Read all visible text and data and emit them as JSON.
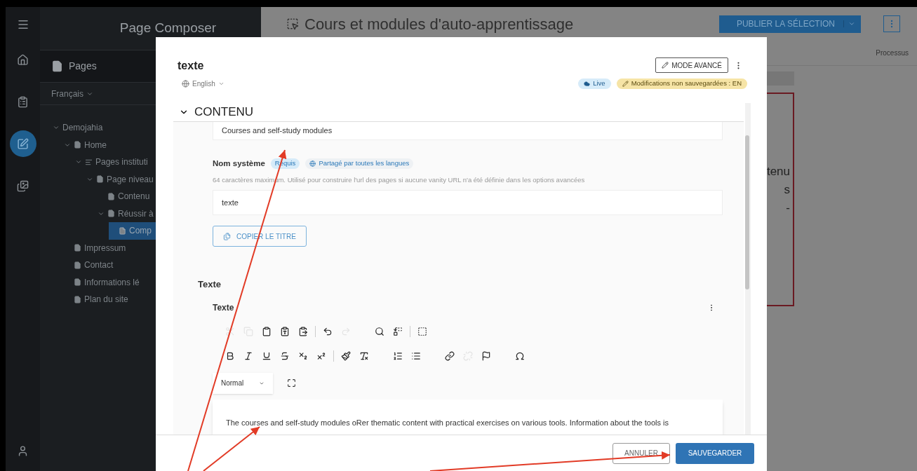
{
  "rail": {
    "items": [
      {
        "kind": "home",
        "selected": false
      },
      {
        "kind": "clipboard",
        "selected": false
      },
      {
        "kind": "edit",
        "selected": true
      },
      {
        "kind": "images",
        "selected": false
      }
    ]
  },
  "sidebar": {
    "title": "Page Composer",
    "section": "Pages",
    "language": "Français",
    "tree": [
      {
        "label": "Demojahia",
        "expanded": true,
        "selected": false,
        "children": [
          {
            "label": "Home",
            "kind": "page",
            "expanded": true,
            "selected": false,
            "children": [
              {
                "label": "Pages instituti",
                "kind": "list",
                "expanded": true,
                "selected": false,
                "children": [
                  {
                    "label": "Page niveau",
                    "kind": "page",
                    "expanded": true,
                    "selected": false,
                    "children": [
                      {
                        "label": "Contenu",
                        "kind": "page",
                        "selected": false
                      },
                      {
                        "label": "Réussir à",
                        "kind": "page",
                        "expanded": true,
                        "selected": false,
                        "children": [
                          {
                            "label": "Comp",
                            "kind": "page",
                            "selected": true
                          }
                        ]
                      }
                    ]
                  }
                ]
              }
            ]
          },
          {
            "label": "Impressum",
            "kind": "page",
            "selected": false
          },
          {
            "label": "Contact",
            "kind": "page",
            "selected": false
          },
          {
            "label": "Informations lé",
            "kind": "page",
            "selected": false
          },
          {
            "label": "Plan du site",
            "kind": "page",
            "selected": false
          }
        ]
      }
    ]
  },
  "main": {
    "title": "Cours et modules d'auto-apprentissage",
    "publish_button": "PUBLIER LA SÉLECTION",
    "column_header": "Processus",
    "preview_lines": [
      "tenu",
      "s",
      "-"
    ]
  },
  "dialog": {
    "title": "texte",
    "language": "English",
    "advanced_button": "MODE AVANCÉ",
    "badges": [
      {
        "label": "Live",
        "kind": "live"
      },
      {
        "label": "Modifications non sauvegardées : EN",
        "kind": "unsaved"
      }
    ],
    "section": {
      "title": "CONTENU",
      "expanded": true
    },
    "title_value": "Courses and self-study modules",
    "system_name": {
      "label": "Nom système",
      "badges": [
        {
          "label": "Requis",
          "kind": "required"
        },
        {
          "label": "Partagé par toutes les langues",
          "kind": "shared"
        }
      ],
      "help": "64 caractères maximum. Utilisé pour construire l'url des pages si aucune vanity URL n'a été définie dans les options avancées",
      "value": "texte"
    },
    "copy_button": "COPIER LE TITRE",
    "text_group": "Texte",
    "text_field": "Texte",
    "toolbar_rows": [
      [
        {
          "kind": "cut",
          "disabled": true
        },
        {
          "kind": "copy",
          "disabled": true
        },
        {
          "kind": "paste",
          "disabled": false
        },
        {
          "kind": "paste-text",
          "disabled": false
        },
        {
          "kind": "paste-word",
          "disabled": false
        },
        {
          "kind": "sep"
        },
        {
          "kind": "undo",
          "disabled": false
        },
        {
          "kind": "redo",
          "disabled": true
        },
        {
          "kind": "gap"
        },
        {
          "kind": "find",
          "disabled": false
        },
        {
          "kind": "replace",
          "disabled": false
        },
        {
          "kind": "sep"
        },
        {
          "kind": "select-all",
          "disabled": false
        }
      ],
      [
        {
          "kind": "bold",
          "disabled": false
        },
        {
          "kind": "italic",
          "disabled": false
        },
        {
          "kind": "underline",
          "disabled": false
        },
        {
          "kind": "strike",
          "disabled": false
        },
        {
          "kind": "subscript",
          "disabled": false
        },
        {
          "kind": "superscript",
          "disabled": false
        },
        {
          "kind": "sep"
        },
        {
          "kind": "format",
          "disabled": false
        },
        {
          "kind": "clear",
          "disabled": false
        },
        {
          "kind": "gap"
        },
        {
          "kind": "ordered",
          "disabled": false
        },
        {
          "kind": "bullets",
          "disabled": false
        },
        {
          "kind": "gap"
        },
        {
          "kind": "link",
          "disabled": false
        },
        {
          "kind": "unlink",
          "disabled": true
        },
        {
          "kind": "anchor",
          "disabled": false
        },
        {
          "kind": "gap"
        },
        {
          "kind": "omega",
          "disabled": false
        }
      ]
    ],
    "style_select": "Normal",
    "body_text": "The courses and self-study modules oRer thematic content with practical exercises on various tools. Information about the tools is",
    "cancel_button": "ANNULER",
    "save_button": "SAUVEGARDER"
  }
}
